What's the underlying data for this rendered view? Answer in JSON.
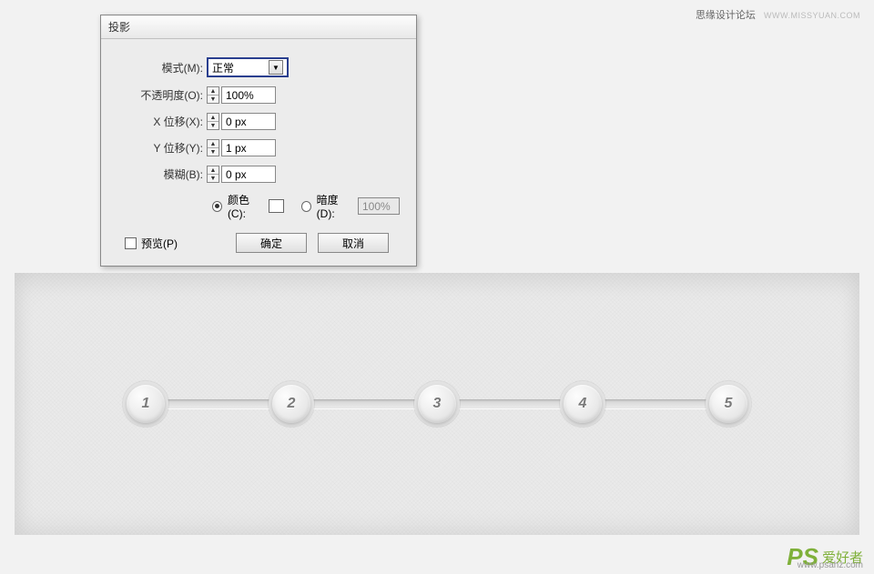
{
  "watermark": {
    "top_site": "思缘设计论坛",
    "top_url": "WWW.MISSYUAN.COM",
    "bottom_logo": "PS",
    "bottom_text": "爱好者",
    "bottom_url": "www.psahz.com"
  },
  "dialog": {
    "title": "投影",
    "mode": {
      "label": "模式(M):",
      "value": "正常"
    },
    "opacity": {
      "label": "不透明度(O):",
      "value": "100%"
    },
    "x_offset": {
      "label": "X 位移(X):",
      "value": "0 px"
    },
    "y_offset": {
      "label": "Y 位移(Y):",
      "value": "1 px"
    },
    "blur": {
      "label": "模糊(B):",
      "value": "0 px"
    },
    "color_label": "颜色(C):",
    "darkness_label": "暗度(D):",
    "darkness_value": "100%",
    "preview_label": "预览(P)",
    "ok": "确定",
    "cancel": "取消"
  },
  "stepper": {
    "nodes": [
      "1",
      "2",
      "3",
      "4",
      "5"
    ]
  }
}
